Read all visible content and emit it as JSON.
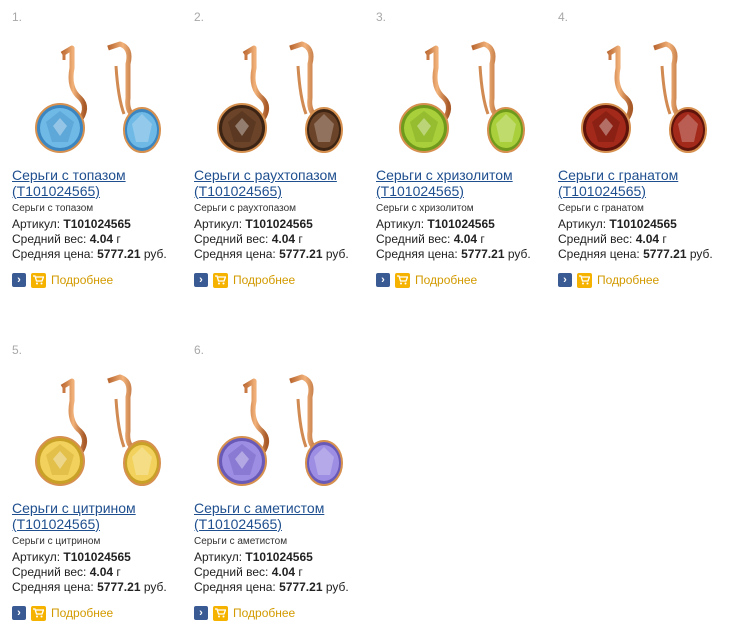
{
  "products": [
    {
      "index": "1.",
      "title_line1": "Серьги с топазом",
      "title_line2": "(Т101024565)",
      "desc": "Серьги с топазом",
      "article_label": "Артикул:",
      "article": "Т101024565",
      "weight_label": "Средний вес:",
      "weight": "4.04",
      "weight_unit": "г",
      "price_label": "Средняя цена:",
      "price": "5777.21",
      "price_unit": "руб.",
      "more_label": "Подробнее",
      "stone_color": "#6fb9e6",
      "stone_dark": "#3b86c0"
    },
    {
      "index": "2.",
      "title_line1": "Серьги с раухтопазом",
      "title_line2": "(Т101024565)",
      "desc": "Серьги с раухтопазом",
      "article_label": "Артикул:",
      "article": "Т101024565",
      "weight_label": "Средний вес:",
      "weight": "4.04",
      "weight_unit": "г",
      "price_label": "Средняя цена:",
      "price": "5777.21",
      "price_unit": "руб.",
      "more_label": "Подробнее",
      "stone_color": "#6b4328",
      "stone_dark": "#3c2414"
    },
    {
      "index": "3.",
      "title_line1": "Серьги с хризолитом",
      "title_line2": "(Т101024565)",
      "desc": "Серьги с хризолитом",
      "article_label": "Артикул:",
      "article": "Т101024565",
      "weight_label": "Средний вес:",
      "weight": "4.04",
      "weight_unit": "г",
      "price_label": "Средняя цена:",
      "price": "5777.21",
      "price_unit": "руб.",
      "more_label": "Подробнее",
      "stone_color": "#a9cf3a",
      "stone_dark": "#6f9a1c"
    },
    {
      "index": "4.",
      "title_line1": "Серьги с гранатом",
      "title_line2": "(Т101024565)",
      "desc": "Серьги с гранатом",
      "article_label": "Артикул:",
      "article": "Т101024565",
      "weight_label": "Средний вес:",
      "weight": "4.04",
      "weight_unit": "г",
      "price_label": "Средняя цена:",
      "price": "5777.21",
      "price_unit": "руб.",
      "more_label": "Подробнее",
      "stone_color": "#a3291a",
      "stone_dark": "#5e130b"
    },
    {
      "index": "5.",
      "title_line1": "Серьги с цитрином",
      "title_line2": "(Т101024565)",
      "desc": "Серьги с цитрином",
      "article_label": "Артикул:",
      "article": "Т101024565",
      "weight_label": "Средний вес:",
      "weight": "4.04",
      "weight_unit": "г",
      "price_label": "Средняя цена:",
      "price": "5777.21",
      "price_unit": "руб.",
      "more_label": "Подробнее",
      "stone_color": "#f2d25c",
      "stone_dark": "#c9a127"
    },
    {
      "index": "6.",
      "title_line1": "Серьги с аметистом",
      "title_line2": "(Т101024565)",
      "desc": "Серьги с аметистом",
      "article_label": "Артикул:",
      "article": "Т101024565",
      "weight_label": "Средний вес:",
      "weight": "4.04",
      "weight_unit": "г",
      "price_label": "Средняя цена:",
      "price": "5777.21",
      "price_unit": "руб.",
      "more_label": "Подробнее",
      "stone_color": "#9d8de3",
      "stone_dark": "#6a5ab8"
    }
  ],
  "icons": {
    "go": "arrow-right-icon",
    "cart": "cart-icon"
  }
}
